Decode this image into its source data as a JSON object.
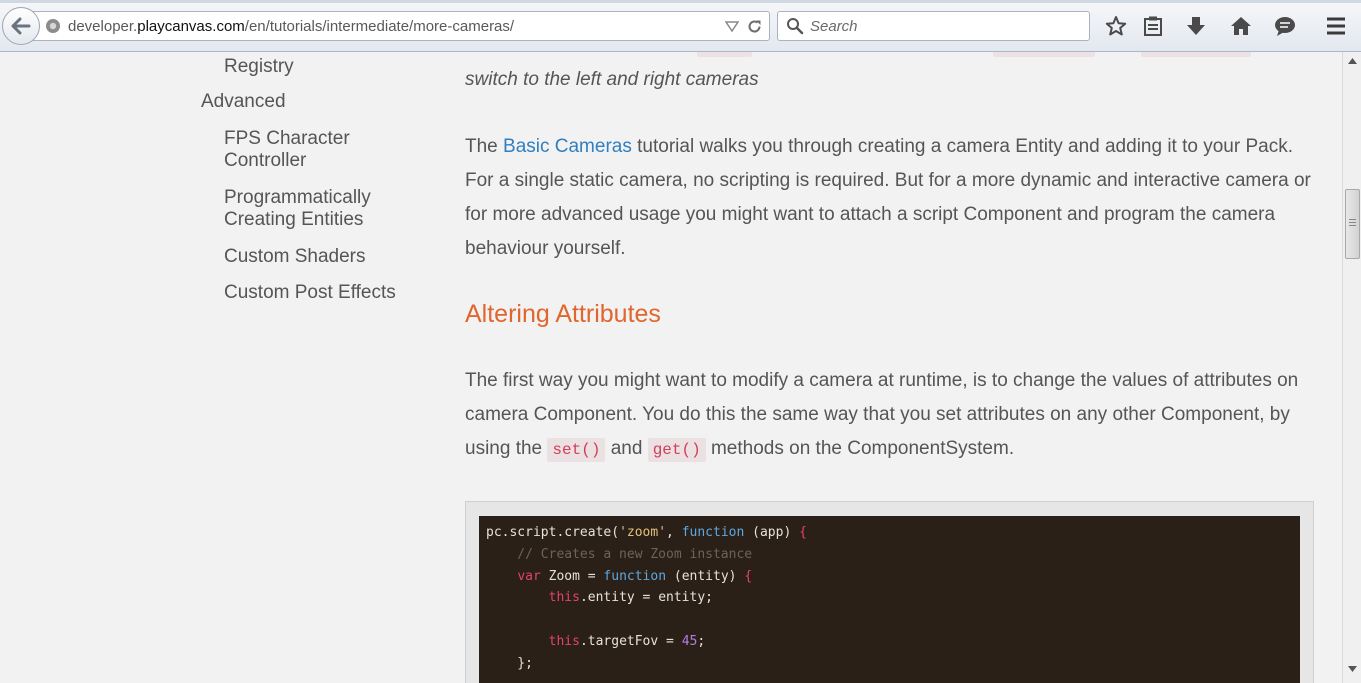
{
  "browser": {
    "url_prefix": "developer.",
    "url_host": "playcanvas.com",
    "url_path": "/en/tutorials/intermediate/more-cameras/",
    "search_placeholder": "Search"
  },
  "sidebar": {
    "registry_label": "Registry",
    "section_advanced": "Advanced",
    "items": [
      {
        "line1": "FPS Character",
        "line2": "Controller"
      },
      {
        "line1": "Programmatically",
        "line2": "Creating Entities"
      },
      {
        "line1": "Custom Shaders",
        "line2": ""
      },
      {
        "line1": "Custom Post Effects",
        "line2": ""
      }
    ]
  },
  "content": {
    "italic_line": "switch to the left and right cameras",
    "para1": {
      "before": "The ",
      "link": "Basic Cameras",
      "after": " tutorial walks you through creating a camera Entity and adding it to your Pack. For a single static camera, no scripting is required. But for a more dynamic and interactive camera or for more advanced usage you might want to attach a script Component and program the camera behaviour yourself."
    },
    "heading": "Altering Attributes",
    "para2": {
      "part1": "The first way you might want to modify a camera at runtime, is to change the values of attributes on camera Component. You do this the same way that you set attributes on any other Component, by using the ",
      "code1": "set()",
      "part2": " and ",
      "code2": "get()",
      "part3": " methods on the ComponentSystem."
    }
  },
  "code": {
    "l1_a": "pc.script.create(",
    "l1_str": "'zoom'",
    "l1_b": ", ",
    "l1_kw": "function",
    "l1_c": " (app) ",
    "l1_brace": "{",
    "l2_comment": "    // Creates a new Zoom instance",
    "l3_indent": "    ",
    "l3_var": "var",
    "l3_a": " Zoom = ",
    "l3_kw": "function",
    "l3_b": " (entity) ",
    "l3_brace": "{",
    "l4_indent": "        ",
    "l4_this": "this",
    "l4_a": ".entity = entity;",
    "l6_indent": "        ",
    "l6_this": "this",
    "l6_a": ".targetFov = ",
    "l6_num": "45",
    "l6_b": ";",
    "l7": "    };"
  }
}
